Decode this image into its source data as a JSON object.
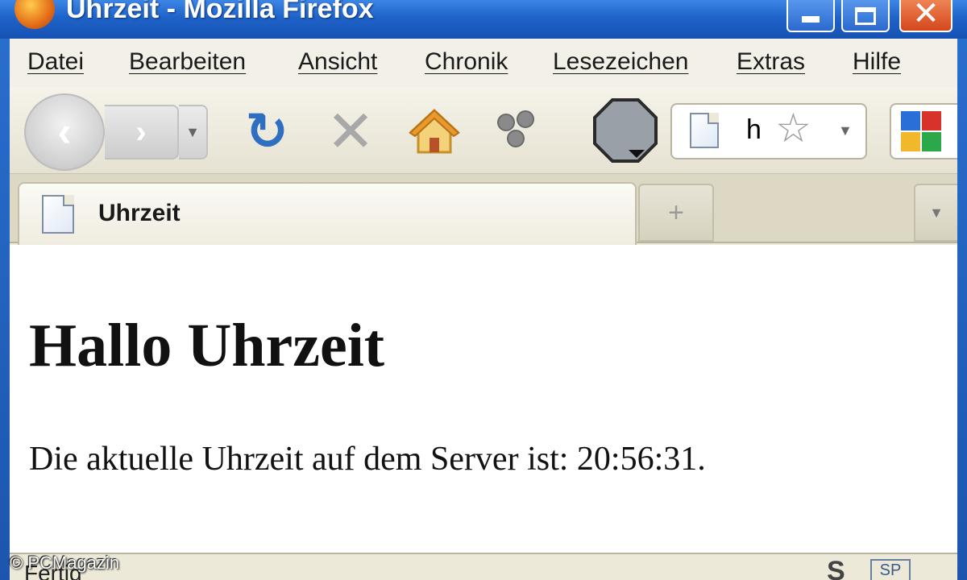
{
  "window": {
    "title": "Uhrzeit - Mozilla Firefox"
  },
  "menu": {
    "items": [
      "Datei",
      "Bearbeiten",
      "Ansicht",
      "Chronik",
      "Lesezeichen",
      "Extras",
      "Hilfe"
    ]
  },
  "toolbar": {
    "url_text": "h",
    "icons": [
      "back-icon",
      "forward-icon",
      "reload-icon",
      "stop-icon",
      "home-icon",
      "extension-icon",
      "stop-sign-icon",
      "bookmark-star-icon",
      "search-engine-icon"
    ]
  },
  "tabs": [
    {
      "label": "Uhrzeit",
      "active": true
    }
  ],
  "content": {
    "heading": "Hallo Uhrzeit",
    "text": "Die aktuelle Uhrzeit auf dem Server ist: 20:56:31."
  },
  "status": {
    "text": "Fertig",
    "s_label": "S",
    "sp_label": "SP"
  },
  "watermark": "© PCMagazin",
  "colors": {
    "titlebar": "#1f63c9",
    "chrome": "#ece9d8",
    "reload": "#2f6fc2"
  }
}
